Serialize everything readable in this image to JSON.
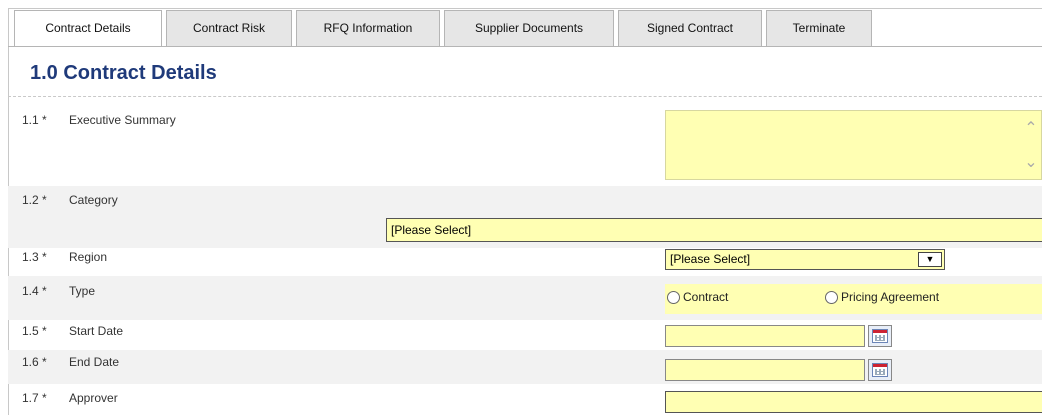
{
  "tabs": [
    {
      "label": "Contract Details",
      "active": true
    },
    {
      "label": "Contract Risk",
      "active": false
    },
    {
      "label": "RFQ Information",
      "active": false
    },
    {
      "label": "Supplier Documents",
      "active": false
    },
    {
      "label": "Signed Contract",
      "active": false
    },
    {
      "label": "Terminate",
      "active": false
    }
  ],
  "section": {
    "title": "1.0 Contract Details"
  },
  "fields": [
    {
      "num": "1.1 *",
      "label": "Executive Summary",
      "value": ""
    },
    {
      "num": "1.2 *",
      "label": "Category",
      "value": "[Please Select]"
    },
    {
      "num": "1.3 *",
      "label": "Region",
      "value": "[Please Select]"
    },
    {
      "num": "1.4 *",
      "label": "Type",
      "options": [
        "Contract",
        "Pricing Agreement"
      ]
    },
    {
      "num": "1.5 *",
      "label": "Start Date",
      "value": ""
    },
    {
      "num": "1.6 *",
      "label": "End Date",
      "value": ""
    },
    {
      "num": "1.7 *",
      "label": "Approver",
      "value": ""
    }
  ],
  "colors": {
    "field_bg": "#ffffb3",
    "title": "#1f3a7a",
    "shaded_row": "#f2f2f2"
  }
}
